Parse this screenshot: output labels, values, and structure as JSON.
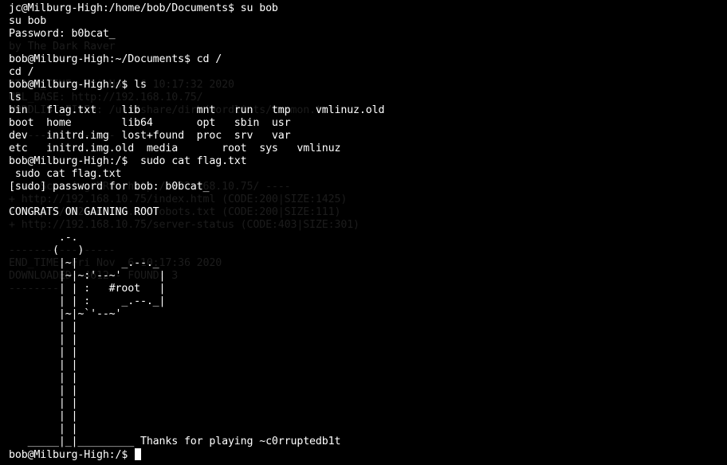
{
  "terminal": {
    "background": "#000000",
    "foreground": "#ffffff",
    "ghost_color": "#1c1c1c",
    "ghost_lines": [
      "by The Dark Raver",
      "START_TIME: Fri Nov  6 10:17:32 2020",
      "URL_BASE: http://192.168.10.75/",
      "WORDLIST_FILES: /usr/share/dirb/wordlists/common.txt",
      "-----------------",
      "---- Scanning URL: http://192.168.10.75/ ----",
      "+ http://192.168.10.75/index.html (CODE:200|SIZE:1425)",
      "+ http://192.168.10.75/robots.txt (CODE:200|SIZE:111)",
      "+ http://192.168.10.75/server-status (CODE:403|SIZE:301)",
      "-----------------",
      "END_TIME: Fri Nov  6 10:17:36 2020",
      "DOWNLOADED: 4612 - FOUND: 3",
      "--------"
    ],
    "lines": [
      "jc@Milburg-High:/home/bob/Documents$ su bob",
      "su bob",
      "Password: b0bcat_",
      "",
      "bob@Milburg-High:~/Documents$ cd /",
      "cd /",
      "bob@Milburg-High:/$ ls",
      "ls",
      "bin   flag.txt    lib         mnt   run   tmp    vmlinuz.old",
      "boot  home        lib64       opt   sbin  usr",
      "dev   initrd.img  lost+found  proc  srv   var",
      "etc   initrd.img.old  media       root  sys   vmlinuz",
      "bob@Milburg-High:/$  sudo cat flag.txt",
      " sudo cat flag.txt",
      "[sudo] password for bob: b0bcat_",
      "",
      "CONGRATS ON GAINING ROOT",
      "",
      "        .-.",
      "       (   )",
      "        |~|       _.--._",
      "        |~|~:'--~'      |",
      "        | | :   #root   |",
      "        | | :     _.--._|",
      "        |~|~`'--~'",
      "        | |",
      "        | |",
      "        | |",
      "        | |",
      "        | |",
      "        | |",
      "        | |",
      "        | |",
      "        | |",
      "   _____|_|_________ Thanks for playing ~c0rruptedb1t",
      "bob@Milburg-High:/$ "
    ]
  }
}
